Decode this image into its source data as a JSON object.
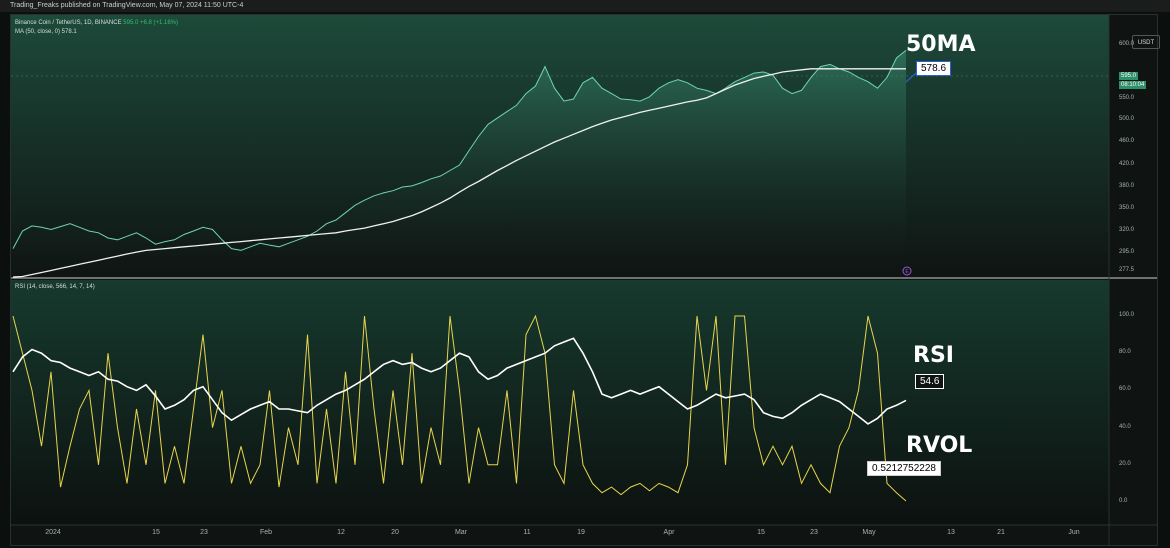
{
  "header": {
    "published": "Trading_Freaks published on TradingView.com, May 07, 2024 11:50 UTC-4"
  },
  "price_pane": {
    "symbol_legend": "Binance Coin / TetherUS, 1D, BINANCE",
    "symbol_quote": "595.0 +6.8 (+1.16%)",
    "ma_legend": "MA (50, close, 0) 578.1",
    "ma_title": "50MA",
    "ma_callout": "578.6",
    "currency_button": "USDT",
    "price_badge": "595.0",
    "countdown_badge": "08:10:04",
    "y_ticks": [
      "600.0",
      "550.0",
      "500.0",
      "460.0",
      "420.0",
      "380.0",
      "350.0",
      "320.0",
      "295.0",
      "277.5"
    ],
    "event_icon": "E"
  },
  "indicator_pane": {
    "legend": "RSI (14, close, 566, 14, 7, 14)",
    "rsi_title": "RSI",
    "rsi_callout": "54.6",
    "rvol_title": "RVOL",
    "rvol_callout": "0.5212752228",
    "y_ticks": [
      "100.0",
      "80.0",
      "60.0",
      "40.0",
      "20.0",
      "0.0"
    ]
  },
  "x_ticks": [
    "2024",
    "15",
    "23",
    "Feb",
    "12",
    "20",
    "Mar",
    "11",
    "19",
    "Apr",
    "15",
    "23",
    "May",
    "13",
    "21",
    "Jun"
  ],
  "colors": {
    "price": "#6fd3b4",
    "ma": "#f0f0f0",
    "rsi": "#ffffff",
    "rvol": "#e8d44d",
    "ma_callout_border": "#2b5fd9"
  },
  "chart_data": [
    {
      "type": "area",
      "series": [
        {
          "name": "Binance Coin / TetherUS",
          "values": [
            300,
            320,
            327,
            325,
            322,
            326,
            330,
            325,
            320,
            318,
            312,
            310,
            314,
            318,
            312,
            305,
            308,
            310,
            316,
            320,
            325,
            322,
            310,
            300,
            298,
            302,
            306,
            304,
            302,
            306,
            310,
            314,
            320,
            330,
            335,
            345,
            355,
            362,
            368,
            372,
            375,
            380,
            382,
            388,
            395,
            400,
            410,
            420,
            445,
            470,
            492,
            505,
            520,
            535,
            555,
            562,
            580,
            560,
            545,
            550,
            565,
            570,
            560,
            555,
            550,
            548,
            545,
            552,
            560,
            565,
            568,
            565,
            560,
            558,
            555,
            560,
            566,
            570,
            574,
            575,
            572,
            560,
            555,
            558,
            570,
            580,
            582,
            578,
            575,
            570,
            566,
            560,
            570,
            588,
            595
          ]
        },
        {
          "name": "MA (50, close, 0)",
          "values": [
            270,
            272,
            274,
            276,
            278,
            280,
            282,
            284,
            286,
            288,
            290,
            292,
            294,
            296,
            298,
            299,
            300,
            301,
            302,
            303,
            304,
            305,
            306,
            307,
            308,
            309,
            310,
            311,
            312,
            313,
            314,
            315,
            316,
            317,
            318,
            320,
            322,
            324,
            327,
            330,
            333,
            337,
            341,
            346,
            352,
            358,
            365,
            373,
            381,
            390,
            400,
            410,
            419,
            428,
            436,
            444,
            452,
            460,
            467,
            474,
            481,
            488,
            494,
            500,
            506,
            512,
            518,
            523,
            528,
            533,
            538,
            543,
            547,
            551,
            555,
            559,
            563,
            566,
            569,
            571,
            573,
            575,
            576,
            577,
            578,
            578,
            578,
            578,
            578,
            578,
            578,
            578,
            578,
            578,
            578
          ]
        }
      ]
    },
    {
      "type": "line",
      "series": [
        {
          "name": "RSI",
          "values": [
            70,
            78,
            82,
            80,
            76,
            75,
            72,
            70,
            68,
            70,
            66,
            65,
            62,
            60,
            63,
            57,
            50,
            52,
            55,
            60,
            62,
            55,
            48,
            44,
            47,
            50,
            52,
            54,
            50,
            50,
            49,
            48,
            52,
            55,
            58,
            60,
            63,
            66,
            70,
            74,
            76,
            74,
            75,
            72,
            70,
            72,
            76,
            80,
            78,
            70,
            66,
            68,
            72,
            74,
            76,
            78,
            80,
            84,
            86,
            88,
            80,
            70,
            58,
            56,
            58,
            60,
            58,
            60,
            62,
            58,
            54,
            50,
            52,
            55,
            58,
            56,
            57,
            58,
            55,
            48,
            46,
            45,
            48,
            52,
            55,
            58,
            56,
            54,
            50,
            46,
            42,
            45,
            50,
            52,
            54.6
          ]
        },
        {
          "name": "RVOL",
          "values": [
            100,
            80,
            60,
            30,
            70,
            8,
            30,
            50,
            60,
            20,
            80,
            40,
            10,
            50,
            20,
            60,
            10,
            30,
            10,
            50,
            90,
            40,
            60,
            10,
            30,
            10,
            20,
            60,
            8,
            40,
            20,
            90,
            10,
            50,
            10,
            70,
            20,
            100,
            50,
            10,
            60,
            20,
            80,
            10,
            40,
            20,
            100,
            60,
            10,
            40,
            20,
            20,
            60,
            10,
            90,
            100,
            80,
            20,
            10,
            60,
            20,
            10,
            5,
            8,
            4,
            8,
            10,
            6,
            10,
            8,
            5,
            20,
            100,
            60,
            100,
            20,
            100,
            100,
            40,
            20,
            30,
            20,
            30,
            10,
            20,
            10,
            5,
            30,
            40,
            60,
            100,
            80,
            10,
            5,
            0.52
          ]
        }
      ]
    }
  ]
}
